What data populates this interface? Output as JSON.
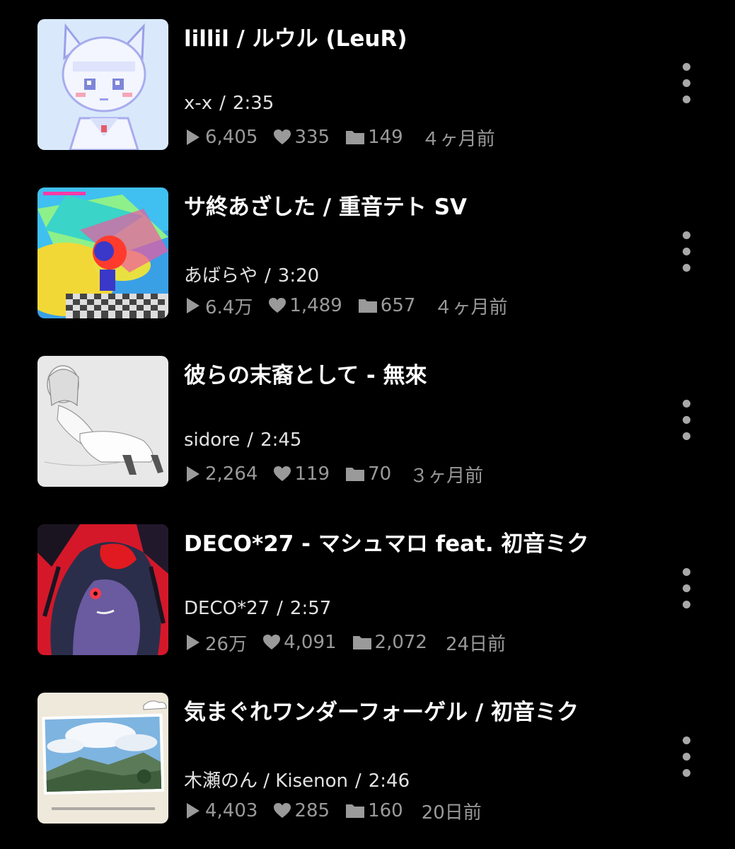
{
  "colors": {
    "background": "#000000",
    "title": "#ffffff",
    "subtitle": "#e2e2e2",
    "stats": "#9a9a9a",
    "menu_dots": "#a8a8a8"
  },
  "icons": {
    "plays": "play-icon",
    "likes": "heart-icon",
    "mylists": "folder-icon",
    "more": "more-vertical-icon"
  },
  "items": [
    {
      "title": "lillil / ルウル (LeuR)",
      "artist": "x-x",
      "duration": "2:35",
      "plays": "6,405",
      "likes": "335",
      "mylists": "149",
      "age": "４ヶ月前"
    },
    {
      "title": "サ終あざした / 重音テト SV",
      "artist": "あばらや",
      "duration": "3:20",
      "plays": "6.4万",
      "likes": "1,489",
      "mylists": "657",
      "age": "４ヶ月前"
    },
    {
      "title": "彼らの末裔として - 無來",
      "artist": "sidore",
      "duration": "2:45",
      "plays": "2,264",
      "likes": "119",
      "mylists": "70",
      "age": "３ヶ月前"
    },
    {
      "title": "DECO*27 - マシュマロ feat. 初音ミク",
      "artist": "DECO*27",
      "duration": "2:57",
      "plays": "26万",
      "likes": "4,091",
      "mylists": "2,072",
      "age": "24日前"
    },
    {
      "title": "気まぐれワンダーフォーゲル / 初音ミク",
      "artist": "木瀬のん / Kisenon",
      "duration": "2:46",
      "plays": "4,403",
      "likes": "285",
      "mylists": "160",
      "age": "20日前"
    }
  ]
}
